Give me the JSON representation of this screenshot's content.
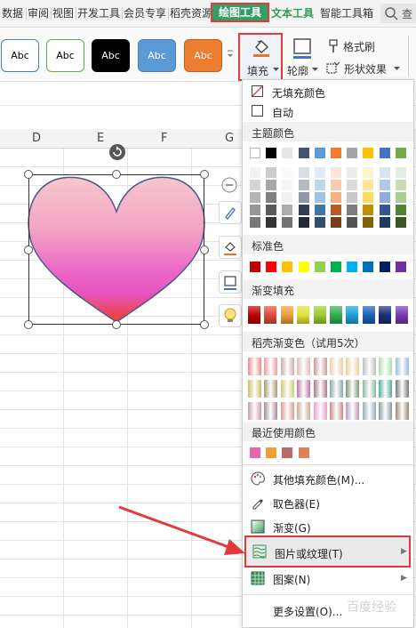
{
  "tabs": [
    "数据",
    "审阅",
    "视图",
    "开发工具",
    "会员专享",
    "稻壳资源",
    "绘图工具",
    "文本工具",
    "智能工具箱"
  ],
  "active_tab": "绘图工具",
  "style_boxes": [
    {
      "label": "Abc",
      "bg": "#ffffff",
      "fg": "#000000",
      "border": "#4a7ebb"
    },
    {
      "label": "Abc",
      "bg": "#ffffff",
      "fg": "#000000",
      "border": "#6aa84f"
    },
    {
      "label": "Abc",
      "bg": "#000000",
      "fg": "#ffffff",
      "border": "#000000"
    },
    {
      "label": "Abc",
      "bg": "#5b9bd5",
      "fg": "#ffffff",
      "border": "#4a7ebb"
    },
    {
      "label": "Abc",
      "bg": "#ed7d31",
      "fg": "#ffffff",
      "border": "#c55a11"
    }
  ],
  "ribbon": {
    "fill": "填充",
    "outline": "轮廓",
    "format_brush": "格式刷",
    "shape_effect": "形状效果"
  },
  "columns": [
    "D",
    "E",
    "F",
    "G"
  ],
  "menu": {
    "no_fill": "无填充颜色",
    "auto": "自动",
    "theme_colors": "主题颜色",
    "standard_colors": "标准色",
    "gradient_fill": "渐变填充",
    "daoke_gradient": "稻壳渐变色（试用5次）",
    "recent_colors": "最近使用颜色",
    "more_fill": "其他填充颜色(M)...",
    "eyedropper": "取色器(E)",
    "gradient": "渐变(G)",
    "picture_texture": "图片或纹理(T)",
    "pattern": "图案(N)",
    "more_settings": "更多设置(O)..."
  },
  "colors": {
    "accent_red": "#e23a3a",
    "tab_green": "#31a062",
    "theme_top": [
      "#ffffff",
      "#000000",
      "#e7e6e6",
      "#44546a",
      "#5b9bd5",
      "#ed7d31",
      "#a5a5a5",
      "#ffc000",
      "#4472c4",
      "#70ad47"
    ],
    "standard": [
      "#c00000",
      "#ff0000",
      "#ffc000",
      "#ffff00",
      "#92d050",
      "#00b050",
      "#00b0f0",
      "#0070c0",
      "#002060",
      "#7030a0"
    ],
    "gradient_fill": [
      "#c00000",
      "#e04b3a",
      "#e8a23a",
      "#e2e23a",
      "#9acd32",
      "#30b050",
      "#1aa3d6",
      "#1a62b8",
      "#1a2f7a",
      "#7a3ab0"
    ],
    "recent": [
      "#e667b0",
      "#f0a030",
      "#b86b6b",
      "#e08060"
    ]
  },
  "watermark": "百度经验"
}
